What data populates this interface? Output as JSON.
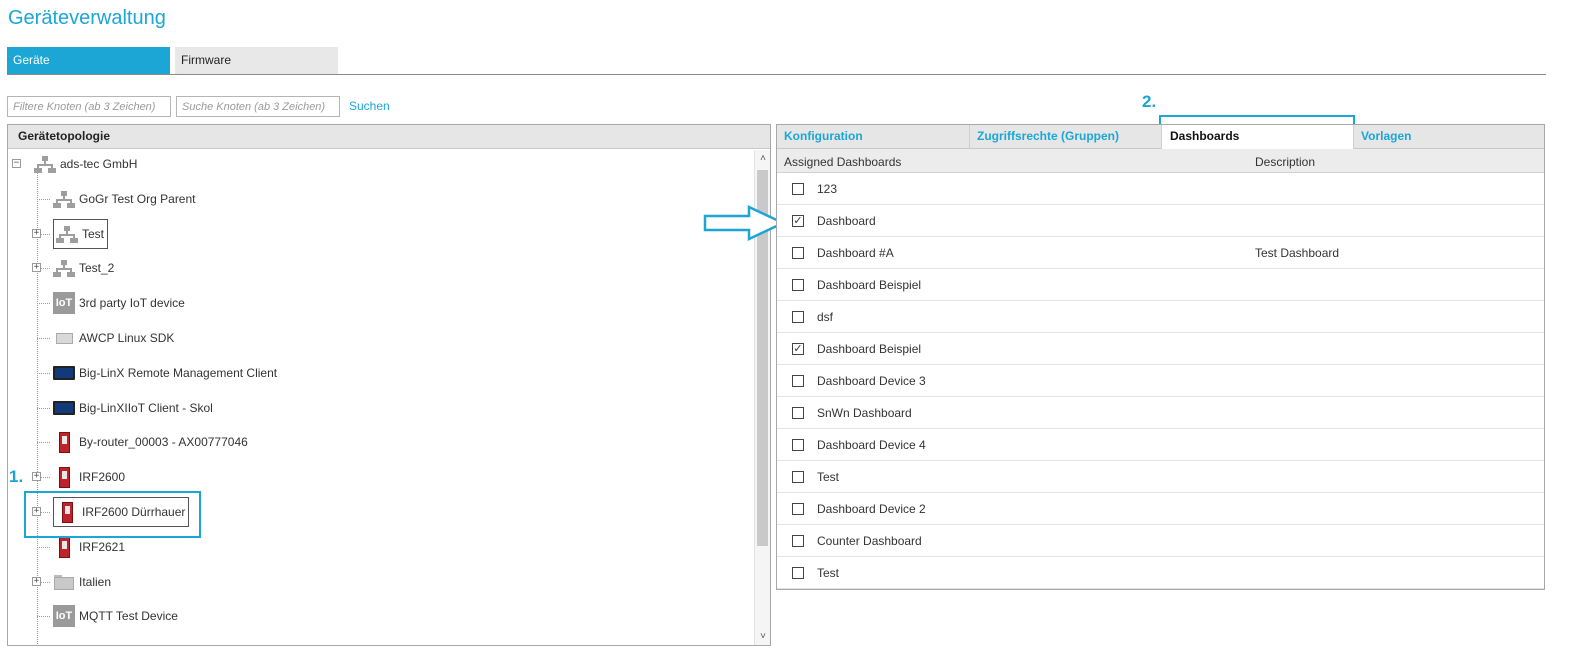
{
  "page": {
    "title": "Geräteverwaltung"
  },
  "main_tabs": [
    {
      "label": "Geräte",
      "active": true
    },
    {
      "label": "Firmware",
      "active": false
    }
  ],
  "filters": {
    "filter_placeholder": "Filtere Knoten (ab 3 Zeichen)",
    "search_placeholder": "Suche Knoten (ab 3 Zeichen)",
    "search_label": "Suchen"
  },
  "tree": {
    "header": "Gerätetopologie",
    "nodes": [
      {
        "label": "ads-tec GmbH",
        "icon": "org-icon",
        "expander": "minus"
      },
      {
        "label": "GoGr Test Org Parent",
        "icon": "org-icon",
        "expander": ""
      },
      {
        "label": "Test",
        "icon": "org-icon",
        "expander": "plus",
        "selected": true
      },
      {
        "label": "Test_2",
        "icon": "org-icon",
        "expander": "plus"
      },
      {
        "label": "3rd party IoT device",
        "icon": "iot-icon",
        "icon_text": "IoT",
        "expander": ""
      },
      {
        "label": "AWCP Linux SDK",
        "icon": "sdk-device-icon",
        "expander": ""
      },
      {
        "label": "Big-LinX Remote Management Client",
        "icon": "screen-device-icon",
        "expander": ""
      },
      {
        "label": "Big-LinXIIoT Client - Skol",
        "icon": "screen-device-icon",
        "expander": ""
      },
      {
        "label": "By-router_00003 - AX00777046",
        "icon": "router-icon",
        "expander": ""
      },
      {
        "label": "IRF2600",
        "icon": "router-icon",
        "expander": "plus"
      },
      {
        "label": "IRF2600 Dürrhauer",
        "icon": "router-icon",
        "expander": "plus",
        "selected": true
      },
      {
        "label": "IRF2621",
        "icon": "router-icon",
        "expander": ""
      },
      {
        "label": "Italien",
        "icon": "folder-icon",
        "expander": "plus"
      },
      {
        "label": "MQTT Test Device",
        "icon": "iot-icon",
        "icon_text": "IoT",
        "expander": ""
      }
    ]
  },
  "annotations": {
    "step1": "1.",
    "step2": "2."
  },
  "right_tabs": [
    {
      "label": "Konfiguration",
      "active": false
    },
    {
      "label": "Zugriffsrechte (Gruppen)",
      "active": false
    },
    {
      "label": "Dashboards",
      "active": true
    },
    {
      "label": "Vorlagen",
      "active": false
    }
  ],
  "dashboards": {
    "col_assigned": "Assigned Dashboards",
    "col_description": "Description",
    "rows": [
      {
        "name": "123",
        "checked": false,
        "description": ""
      },
      {
        "name": "Dashboard",
        "checked": true,
        "description": ""
      },
      {
        "name": "Dashboard #A",
        "checked": false,
        "description": "Test Dashboard"
      },
      {
        "name": "Dashboard Beispiel",
        "checked": false,
        "description": ""
      },
      {
        "name": "dsf",
        "checked": false,
        "description": ""
      },
      {
        "name": "Dashboard Beispiel",
        "checked": true,
        "description": ""
      },
      {
        "name": "Dashboard Device 3",
        "checked": false,
        "description": ""
      },
      {
        "name": "SnWn Dashboard",
        "checked": false,
        "description": ""
      },
      {
        "name": "Dashboard Device 4",
        "checked": false,
        "description": ""
      },
      {
        "name": "Test",
        "checked": false,
        "description": ""
      },
      {
        "name": "Dashboard Device 2",
        "checked": false,
        "description": ""
      },
      {
        "name": "Counter Dashboard",
        "checked": false,
        "description": ""
      },
      {
        "name": "Test",
        "checked": false,
        "description": ""
      }
    ]
  },
  "colors": {
    "accent": "#1ba6d6",
    "router_red": "#c0222a",
    "org_gray": "#9e9e9e"
  }
}
